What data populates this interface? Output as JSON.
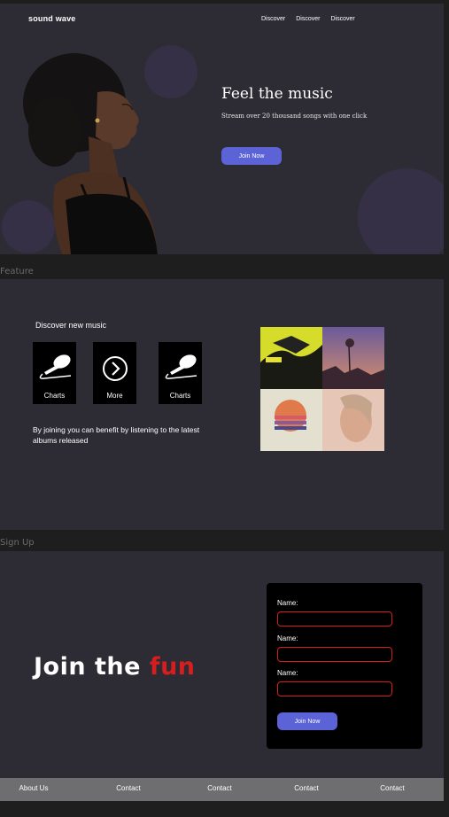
{
  "frames": {
    "feature_label": "Feature",
    "signup_label": "Sign Up"
  },
  "header": {
    "brand": "sound wave",
    "nav": [
      "Discover",
      "Discover",
      "Discover"
    ]
  },
  "hero": {
    "title": "Feel the music",
    "subtitle": "Stream over 20 thousand songs with one click",
    "cta": "Join Now"
  },
  "feature": {
    "title": "Discover new music",
    "cards": [
      {
        "label": "Charts",
        "icon": "microphone-icon"
      },
      {
        "label": "More",
        "icon": "chevron-right-circle-icon"
      },
      {
        "label": "Charts",
        "icon": "microphone-icon"
      }
    ],
    "description": "By joining you can benefit by listening to the latest albums released"
  },
  "signup": {
    "headline_prefix": "Join the",
    "headline_highlight": "fun",
    "fields": [
      {
        "label": "Name:",
        "value": ""
      },
      {
        "label": "Name:",
        "value": ""
      },
      {
        "label": "Name:",
        "value": ""
      }
    ],
    "submit": "Join Now"
  },
  "footer": {
    "links": [
      "About Us",
      "Contact",
      "Contact",
      "Contact",
      "Contact"
    ]
  },
  "colors": {
    "background": "#2d2c35",
    "accent": "#5b63d6",
    "highlight": "#d61e1e",
    "footer": "#6e6e70"
  }
}
